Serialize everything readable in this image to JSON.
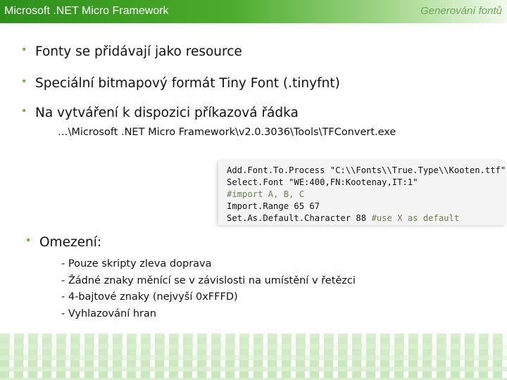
{
  "header": {
    "title": "Microsoft .NET Micro Framework",
    "section": "Generování fontů"
  },
  "bullets": [
    "Fonty se přidávají jako resource",
    "Speciální bitmapový formát Tiny Font (.tinyfnt)",
    "Na vytváření k dispozici příkazová řádka"
  ],
  "tool_path": "…\\Microsoft .NET Micro Framework\\v2.0.3036\\Tools\\TFConvert.exe",
  "code": {
    "line1": "Add.Font.To.Process \"C:\\\\Fonts\\\\True.Type\\\\Kooten.ttf\"",
    "line2": "Select.Font \"WE:400,FN:Kootenay,IT:1\"",
    "line3": "#import A, B, C",
    "line4": "Import.Range 65 67",
    "line5_main": "Set.As.Default.Character 88 ",
    "line5_comment": "#use X as default"
  },
  "limits_title": "Omezení:",
  "limits": [
    "- Pouze skripty zleva doprava",
    "- Žádné znaky měnící se v závislosti na umístění v řetězci",
    "- 4-bajtové znaky (nejvyší 0xFFFD)",
    "- Vyhlazování hran"
  ],
  "bullet_symbol": "•",
  "accent_color": "#5cb233"
}
